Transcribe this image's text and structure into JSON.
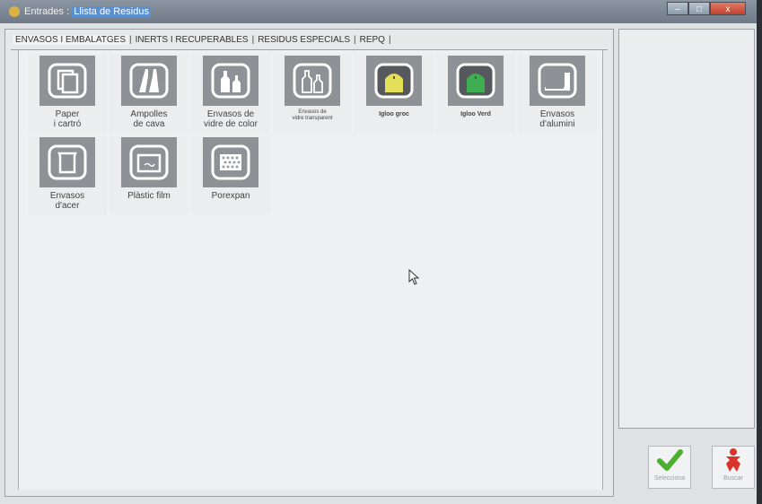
{
  "window": {
    "title_prefix": "Entrades : ",
    "title_highlight": "Llista de Residus",
    "buttons": {
      "minimize": "–",
      "maximize": "□",
      "close": "x"
    }
  },
  "tabs": [
    {
      "label": "ENVASOS I EMBALATGES",
      "active": true
    },
    {
      "label": "INERTS I RECUPERABLES",
      "active": false
    },
    {
      "label": "RESIDUS ESPECIALS",
      "active": false
    },
    {
      "label": "REPQ",
      "active": false
    }
  ],
  "tiles": [
    {
      "label": "Paper\ni cartró",
      "icon": "paper-icon"
    },
    {
      "label": "Ampolles\nde cava",
      "icon": "cava-bottles-icon"
    },
    {
      "label": "Envasos de\nvidre de color",
      "icon": "color-glass-icon"
    },
    {
      "label": "Envasos de\nvidre transparent",
      "icon": "clear-glass-icon"
    },
    {
      "label": "Igloo groc",
      "icon": "yellow-igloo-icon",
      "color": "#e4e05a"
    },
    {
      "label": "Igloo Verd",
      "icon": "green-igloo-icon",
      "color": "#3fae52"
    },
    {
      "label": "Envasos\nd'alumini",
      "icon": "aluminium-icon"
    },
    {
      "label": "Envasos\nd'acer",
      "icon": "steel-can-icon"
    },
    {
      "label": "Plàstic film",
      "icon": "plastic-film-icon"
    },
    {
      "label": "Porexpan",
      "icon": "porexpan-icon"
    }
  ],
  "actions": {
    "select_label": "Selecciona",
    "search_label": "Buscar",
    "select_color": "#4caf2f",
    "search_color": "#d9342b"
  }
}
